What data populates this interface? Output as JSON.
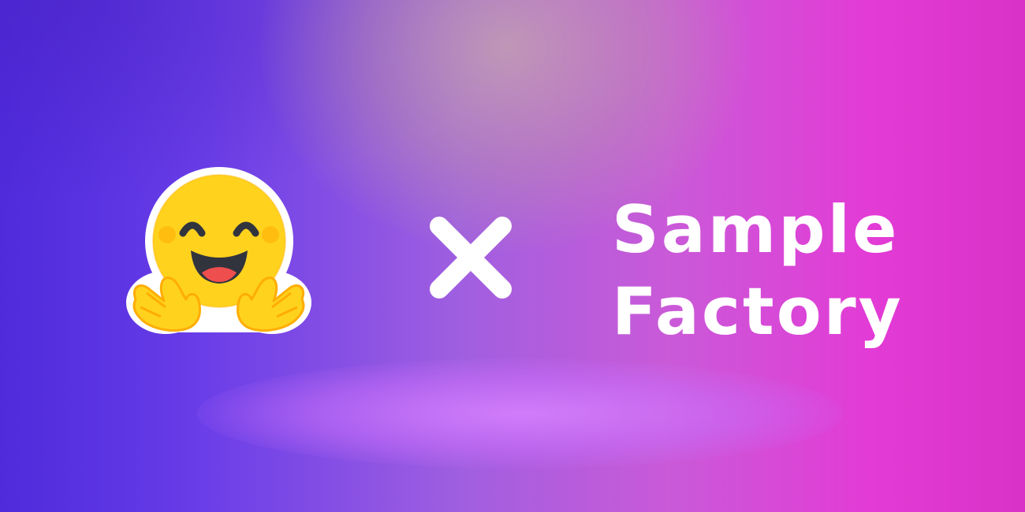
{
  "banner": {
    "title_line1": "Sample",
    "title_line2": "Factory",
    "logo_icon": "hugging-face-icon",
    "separator_icon": "times-icon",
    "colors": {
      "gradient_left": "#5a32e6",
      "gradient_right": "#e33bd6",
      "text": "#ffffff",
      "emoji_face": "#ffd21e",
      "emoji_outline": "#ffffff"
    }
  }
}
